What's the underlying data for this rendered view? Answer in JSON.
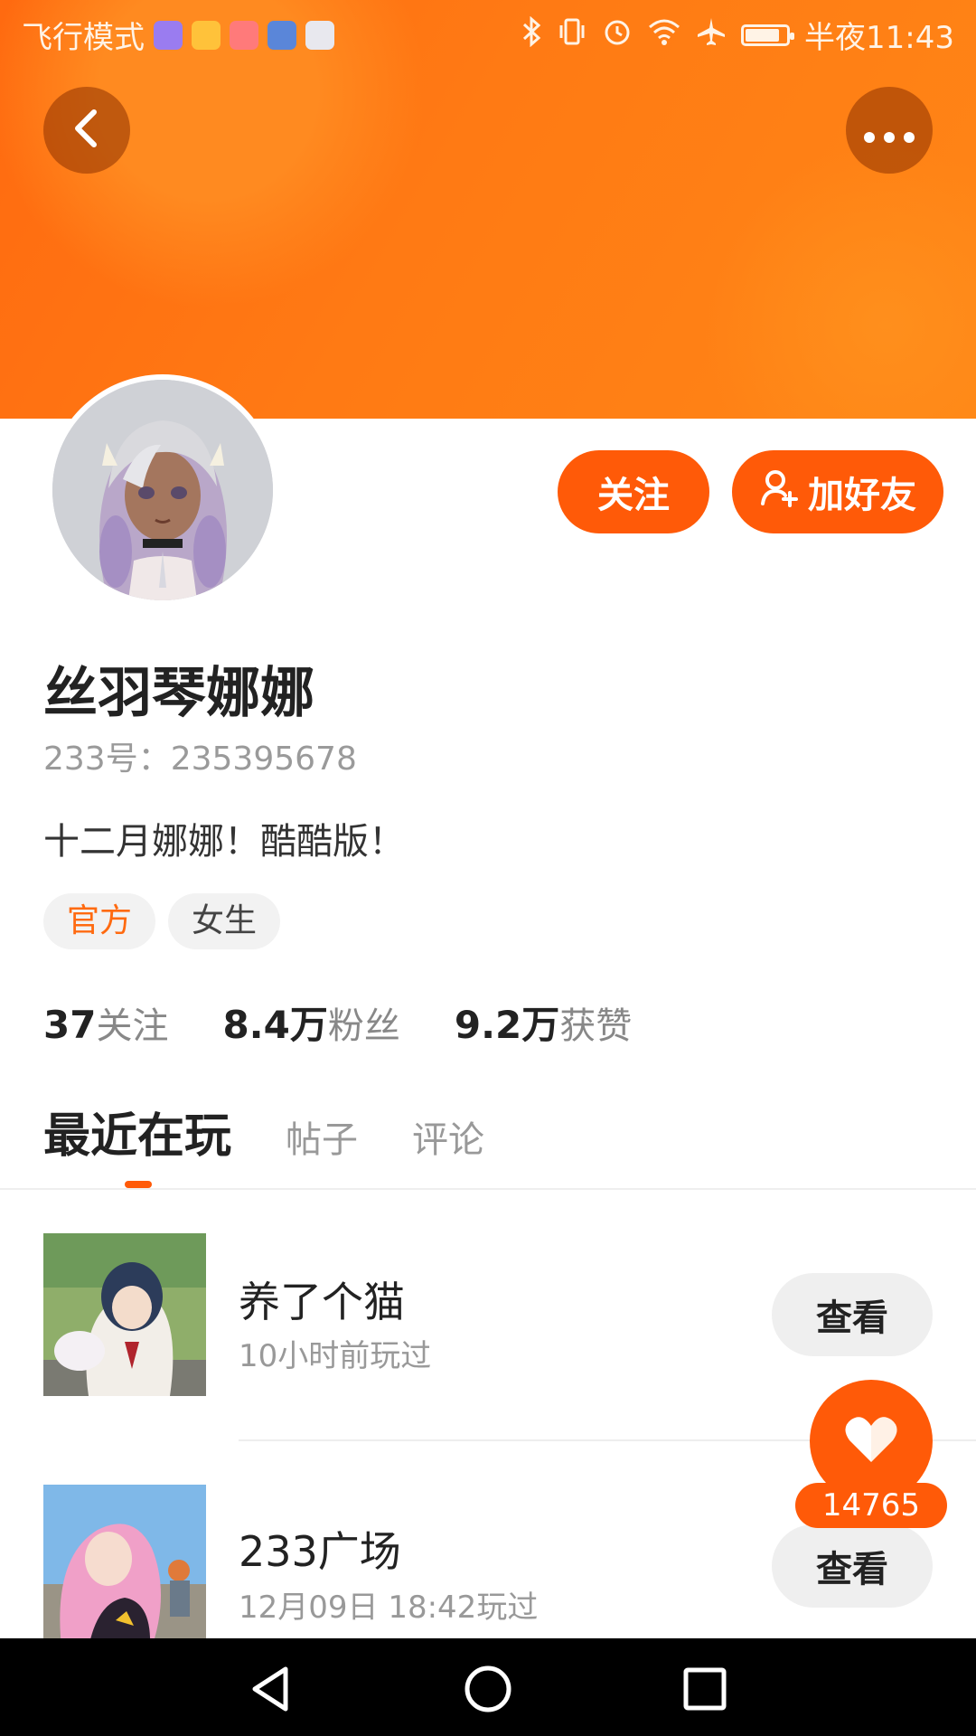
{
  "status_bar": {
    "left_text": "飞行模式",
    "time": "半夜11:43",
    "app_icons": [
      "music-app-icon",
      "folder-app-icon",
      "video-app-icon",
      "browser-app-icon",
      "storage-app-icon"
    ],
    "right_icons": [
      "bluetooth-icon",
      "vibrate-icon",
      "alarm-icon",
      "wifi-icon",
      "airplane-icon",
      "battery-icon"
    ],
    "battery_level": 0.85
  },
  "colors": {
    "accent": "#ff5a08",
    "header_gradient": [
      "#ff6a10",
      "#ff8616"
    ]
  },
  "header": {
    "back_icon": "back-arrow-icon",
    "more_icon": "more-dots-icon"
  },
  "profile": {
    "name": "丝羽琴娜娜",
    "uid": "233号：235395678",
    "bio": "十二月娜娜！酷酷版！",
    "tags": [
      "官方",
      "女生"
    ],
    "follow_button": "关注",
    "add_friend_button": "加好友"
  },
  "stats": [
    {
      "value": "37",
      "label": "关注"
    },
    {
      "value": "8.4万",
      "label": "粉丝"
    },
    {
      "value": "9.2万",
      "label": "获赞"
    }
  ],
  "tabs": [
    "最近在玩",
    "帖子",
    "评论"
  ],
  "games": [
    {
      "title": "养了个猫",
      "time": "10小时前玩过",
      "button": "查看"
    },
    {
      "title": "233广场",
      "time": "12月09日 18:42玩过",
      "button": "查看"
    }
  ],
  "like": {
    "count": "14765"
  },
  "nav_bar": [
    "back-triangle-icon",
    "home-circle-icon",
    "recents-square-icon"
  ]
}
